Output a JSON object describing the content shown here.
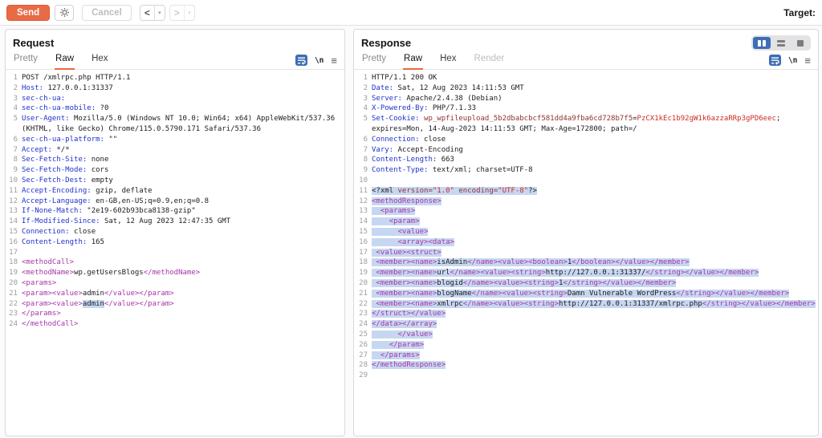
{
  "colors": {
    "accent_orange": "#e8693f",
    "send_button": "#e96b46",
    "selection_highlight": "#c7d7f1",
    "layout_toggle_selected": "#3e6db5",
    "syntax_header_name": "#2032c9",
    "syntax_tag": "#a636a8",
    "syntax_attr_name": "#8e3232",
    "syntax_value": "#cb2d24"
  },
  "toolbar": {
    "send_label": "Send",
    "cancel_label": "Cancel",
    "back_glyph": "<",
    "forward_glyph": ">",
    "dropdown_glyph": "▾",
    "target_label": "Target:"
  },
  "icons": {
    "gear": "gear-icon",
    "soft_wrap": "wrap-icon",
    "newline_glyph": "\\n",
    "menu_glyph": "≡"
  },
  "request": {
    "title": "Request",
    "tabs": [
      {
        "label": "Pretty",
        "state": "muted"
      },
      {
        "label": "Raw",
        "state": "selected"
      },
      {
        "label": "Hex",
        "state": "normal"
      }
    ],
    "lines": [
      {
        "n": "1",
        "seg": [
          [
            "t",
            "POST /xmlrpc.php HTTP/1.1"
          ]
        ]
      },
      {
        "n": "2",
        "seg": [
          [
            "h",
            "Host:"
          ],
          [
            "t",
            " 127.0.0.1:31337"
          ]
        ]
      },
      {
        "n": "3",
        "seg": [
          [
            "h",
            "sec-ch-ua:"
          ],
          [
            "t",
            " "
          ]
        ]
      },
      {
        "n": "4",
        "seg": [
          [
            "h",
            "sec-ch-ua-mobile:"
          ],
          [
            "t",
            " ?0"
          ]
        ]
      },
      {
        "n": "5",
        "seg": [
          [
            "h",
            "User-Agent:"
          ],
          [
            "t",
            " Mozilla/5.0 (Windows NT 10.0; Win64; x64) AppleWebKit/537.36 (KHTML, like Gecko) Chrome/115.0.5790.171 Safari/537.36"
          ]
        ]
      },
      {
        "n": "6",
        "seg": [
          [
            "h",
            "sec-ch-ua-platform:"
          ],
          [
            "t",
            " \"\""
          ]
        ]
      },
      {
        "n": "7",
        "seg": [
          [
            "h",
            "Accept:"
          ],
          [
            "t",
            " */*"
          ]
        ]
      },
      {
        "n": "8",
        "seg": [
          [
            "h",
            "Sec-Fetch-Site:"
          ],
          [
            "t",
            " none"
          ]
        ]
      },
      {
        "n": "9",
        "seg": [
          [
            "h",
            "Sec-Fetch-Mode:"
          ],
          [
            "t",
            " cors"
          ]
        ]
      },
      {
        "n": "10",
        "seg": [
          [
            "h",
            "Sec-Fetch-Dest:"
          ],
          [
            "t",
            " empty"
          ]
        ]
      },
      {
        "n": "11",
        "seg": [
          [
            "h",
            "Accept-Encoding:"
          ],
          [
            "t",
            " gzip, deflate"
          ]
        ]
      },
      {
        "n": "12",
        "seg": [
          [
            "h",
            "Accept-Language:"
          ],
          [
            "t",
            " en-GB,en-US;q=0.9,en;q=0.8"
          ]
        ]
      },
      {
        "n": "13",
        "seg": [
          [
            "h",
            "If-None-Match:"
          ],
          [
            "t",
            " \"2e19-602b93bca8138-gzip\""
          ]
        ]
      },
      {
        "n": "14",
        "seg": [
          [
            "h",
            "If-Modified-Since:"
          ],
          [
            "t",
            " Sat, 12 Aug 2023 12:47:35 GMT"
          ]
        ]
      },
      {
        "n": "15",
        "seg": [
          [
            "h",
            "Connection:"
          ],
          [
            "t",
            " close"
          ]
        ]
      },
      {
        "n": "16",
        "seg": [
          [
            "h",
            "Content-Length:"
          ],
          [
            "t",
            " 165"
          ]
        ]
      },
      {
        "n": "17",
        "seg": []
      },
      {
        "n": "18",
        "seg": [
          [
            "g",
            "<methodCall>"
          ]
        ]
      },
      {
        "n": "19",
        "seg": [
          [
            "g",
            "<methodName>"
          ],
          [
            "t",
            "wp.getUsersBlogs"
          ],
          [
            "g",
            "</methodName>"
          ]
        ]
      },
      {
        "n": "20",
        "seg": [
          [
            "g",
            "<params>"
          ]
        ]
      },
      {
        "n": "21",
        "seg": [
          [
            "g",
            "<param><value>"
          ],
          [
            "t",
            "admin"
          ],
          [
            "g",
            "</value></param>"
          ]
        ]
      },
      {
        "n": "22",
        "seg": [
          [
            "g",
            "<param><value>"
          ],
          [
            "m",
            "admin"
          ],
          [
            "g",
            "</value></param>"
          ]
        ]
      },
      {
        "n": "23",
        "seg": [
          [
            "g",
            "</params>"
          ]
        ]
      },
      {
        "n": "24",
        "seg": [
          [
            "g",
            "</methodCall>"
          ]
        ]
      }
    ]
  },
  "response": {
    "title": "Response",
    "tabs": [
      {
        "label": "Pretty",
        "state": "muted"
      },
      {
        "label": "Raw",
        "state": "selected"
      },
      {
        "label": "Hex",
        "state": "normal"
      },
      {
        "label": "Render",
        "state": "disabled"
      }
    ],
    "layout_buttons": [
      "columns-layout",
      "rows-layout",
      "single-layout"
    ],
    "lines": [
      {
        "n": "1",
        "seg": [
          [
            "t",
            "HTTP/1.1 200 OK"
          ]
        ]
      },
      {
        "n": "2",
        "seg": [
          [
            "h",
            "Date:"
          ],
          [
            "t",
            " Sat, 12 Aug 2023 14:11:53 GMT"
          ]
        ]
      },
      {
        "n": "3",
        "seg": [
          [
            "h",
            "Server:"
          ],
          [
            "t",
            " Apache/2.4.38 (Debian)"
          ]
        ]
      },
      {
        "n": "4",
        "seg": [
          [
            "h",
            "X-Powered-By:"
          ],
          [
            "t",
            " PHP/7.1.33"
          ]
        ]
      },
      {
        "n": "5",
        "seg": [
          [
            "h",
            "Set-Cookie:"
          ],
          [
            "t",
            " "
          ],
          [
            "a",
            "wp_wpfileupload_5b2dbabcbcf581dd4a9fba6cd728b7f5"
          ],
          [
            "t",
            "="
          ],
          [
            "v",
            "PzCX1kEc1b92gW1k6azzaRRp3gPD6eec"
          ],
          [
            "t",
            "; expires=Mon, 14-Aug-2023 14:11:53 GMT; Max-Age=172800; path=/"
          ]
        ]
      },
      {
        "n": "6",
        "seg": [
          [
            "h",
            "Connection:"
          ],
          [
            "t",
            " close"
          ]
        ]
      },
      {
        "n": "7",
        "seg": [
          [
            "h",
            "Vary:"
          ],
          [
            "t",
            " Accept-Encoding"
          ]
        ]
      },
      {
        "n": "8",
        "seg": [
          [
            "h",
            "Content-Length:"
          ],
          [
            "t",
            " 663"
          ]
        ]
      },
      {
        "n": "9",
        "seg": [
          [
            "h",
            "Content-Type:"
          ],
          [
            "t",
            " text/xml; charset=UTF-8"
          ]
        ]
      },
      {
        "n": "10",
        "seg": []
      },
      {
        "n": "11",
        "sel": true,
        "seg": [
          [
            "t",
            "<?xml "
          ],
          [
            "a",
            "version="
          ],
          [
            "v",
            "\"1.0\""
          ],
          [
            "t",
            " "
          ],
          [
            "a",
            "encoding="
          ],
          [
            "v",
            "\"UTF-8\""
          ],
          [
            "t",
            "?>"
          ]
        ]
      },
      {
        "n": "12",
        "sel": true,
        "seg": [
          [
            "g",
            "<methodResponse>"
          ]
        ]
      },
      {
        "n": "13",
        "sel": true,
        "seg": [
          [
            "t",
            "  "
          ],
          [
            "g",
            "<params>"
          ]
        ]
      },
      {
        "n": "14",
        "sel": true,
        "seg": [
          [
            "t",
            "    "
          ],
          [
            "g",
            "<param>"
          ]
        ]
      },
      {
        "n": "15",
        "sel": true,
        "seg": [
          [
            "t",
            "      "
          ],
          [
            "g",
            "<value>"
          ]
        ]
      },
      {
        "n": "16",
        "sel": true,
        "seg": [
          [
            "t",
            "      "
          ],
          [
            "g",
            "<array><data>"
          ]
        ]
      },
      {
        "n": "17",
        "sel": true,
        "seg": [
          [
            "t",
            " "
          ],
          [
            "g",
            "<value><struct>"
          ]
        ]
      },
      {
        "n": "18",
        "sel": true,
        "seg": [
          [
            "t",
            " "
          ],
          [
            "g",
            "<member><name>"
          ],
          [
            "t",
            "isAdmin"
          ],
          [
            "g",
            "</name><value><boolean>"
          ],
          [
            "t",
            "1"
          ],
          [
            "g",
            "</boolean></value></member>"
          ]
        ]
      },
      {
        "n": "19",
        "sel": true,
        "seg": [
          [
            "t",
            " "
          ],
          [
            "g",
            "<member><name>"
          ],
          [
            "t",
            "url"
          ],
          [
            "g",
            "</name><value><string>"
          ],
          [
            "t",
            "http://127.0.0.1:31337/"
          ],
          [
            "g",
            "</string></value></member>"
          ]
        ]
      },
      {
        "n": "20",
        "sel": true,
        "seg": [
          [
            "t",
            " "
          ],
          [
            "g",
            "<member><name>"
          ],
          [
            "t",
            "blogid"
          ],
          [
            "g",
            "</name><value><string>"
          ],
          [
            "t",
            "1"
          ],
          [
            "g",
            "</string></value></member>"
          ]
        ]
      },
      {
        "n": "21",
        "sel": true,
        "seg": [
          [
            "t",
            " "
          ],
          [
            "g",
            "<member><name>"
          ],
          [
            "t",
            "blogName"
          ],
          [
            "g",
            "</name><value><string>"
          ],
          [
            "t",
            "Damn Vulnerable WordPress"
          ],
          [
            "g",
            "</string></value></member>"
          ]
        ]
      },
      {
        "n": "22",
        "sel": true,
        "seg": [
          [
            "t",
            " "
          ],
          [
            "g",
            "<member><name>"
          ],
          [
            "t",
            "xmlrpc"
          ],
          [
            "g",
            "</name><value><string>"
          ],
          [
            "t",
            "http://127.0.0.1:31337/xmlrpc.php"
          ],
          [
            "g",
            "</string></value></member>"
          ]
        ]
      },
      {
        "n": "23",
        "sel": true,
        "seg": [
          [
            "g",
            "</struct></value>"
          ]
        ]
      },
      {
        "n": "24",
        "sel": true,
        "seg": [
          [
            "g",
            "</data></array>"
          ]
        ]
      },
      {
        "n": "25",
        "sel": true,
        "seg": [
          [
            "t",
            "      "
          ],
          [
            "g",
            "</value>"
          ]
        ]
      },
      {
        "n": "26",
        "sel": true,
        "seg": [
          [
            "t",
            "    "
          ],
          [
            "g",
            "</param>"
          ]
        ]
      },
      {
        "n": "27",
        "sel": true,
        "seg": [
          [
            "t",
            "  "
          ],
          [
            "g",
            "</params>"
          ]
        ]
      },
      {
        "n": "28",
        "sel": true,
        "seg": [
          [
            "g",
            "</methodResponse>"
          ]
        ]
      },
      {
        "n": "29",
        "seg": []
      }
    ]
  }
}
